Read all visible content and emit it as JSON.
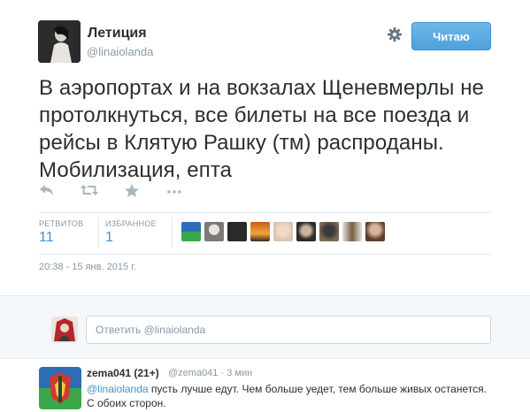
{
  "tweet": {
    "author_name": "Летиция",
    "author_handle": "@linaiolanda",
    "follow_label": "Читаю",
    "text": "В аэропортах и на вокзалах Щеневмерлы не протолкнуться, все билеты на все поезда и рейсы в Клятую Рашку  (тм) распроданы. Мобилизация, епта",
    "stats": {
      "retweets_label": "РЕТВИТОВ",
      "retweets_value": "11",
      "favorites_label": "ИЗБРАННОЕ",
      "favorites_value": "1"
    },
    "timestamp": "20:38 - 15 янв. 2015 г."
  },
  "icons": [
    "reply-icon",
    "retweet-icon",
    "favorite-icon",
    "more-icon",
    "gear-icon"
  ],
  "colors": {
    "follow_button": "#4ea1dc",
    "link": "#4a90c8",
    "muted": "#8899a6"
  },
  "reply_box": {
    "placeholder": "Ответить @linaiolanda"
  },
  "reply": {
    "author_name": "zema041 (21+)",
    "author_handle": "@zema041",
    "separator": "·",
    "time": "3 мин",
    "mention": "@linaiolanda",
    "text": " пусть лучше едут.  Чем больше уедет, тем больше живых останется. С обоих сторон."
  }
}
